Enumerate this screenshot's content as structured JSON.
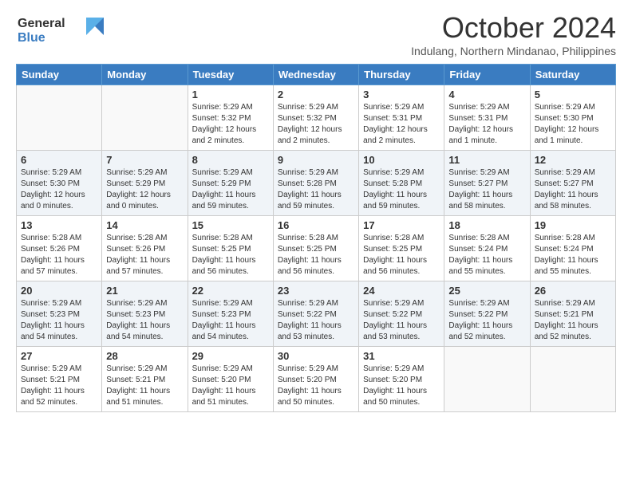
{
  "header": {
    "logo_line1": "General",
    "logo_line2": "Blue",
    "month": "October 2024",
    "location": "Indulang, Northern Mindanao, Philippines"
  },
  "days_of_week": [
    "Sunday",
    "Monday",
    "Tuesday",
    "Wednesday",
    "Thursday",
    "Friday",
    "Saturday"
  ],
  "weeks": [
    [
      {
        "day": "",
        "sunrise": "",
        "sunset": "",
        "daylight": ""
      },
      {
        "day": "",
        "sunrise": "",
        "sunset": "",
        "daylight": ""
      },
      {
        "day": "1",
        "sunrise": "Sunrise: 5:29 AM",
        "sunset": "Sunset: 5:32 PM",
        "daylight": "Daylight: 12 hours and 2 minutes."
      },
      {
        "day": "2",
        "sunrise": "Sunrise: 5:29 AM",
        "sunset": "Sunset: 5:32 PM",
        "daylight": "Daylight: 12 hours and 2 minutes."
      },
      {
        "day": "3",
        "sunrise": "Sunrise: 5:29 AM",
        "sunset": "Sunset: 5:31 PM",
        "daylight": "Daylight: 12 hours and 2 minutes."
      },
      {
        "day": "4",
        "sunrise": "Sunrise: 5:29 AM",
        "sunset": "Sunset: 5:31 PM",
        "daylight": "Daylight: 12 hours and 1 minute."
      },
      {
        "day": "5",
        "sunrise": "Sunrise: 5:29 AM",
        "sunset": "Sunset: 5:30 PM",
        "daylight": "Daylight: 12 hours and 1 minute."
      }
    ],
    [
      {
        "day": "6",
        "sunrise": "Sunrise: 5:29 AM",
        "sunset": "Sunset: 5:30 PM",
        "daylight": "Daylight: 12 hours and 0 minutes."
      },
      {
        "day": "7",
        "sunrise": "Sunrise: 5:29 AM",
        "sunset": "Sunset: 5:29 PM",
        "daylight": "Daylight: 12 hours and 0 minutes."
      },
      {
        "day": "8",
        "sunrise": "Sunrise: 5:29 AM",
        "sunset": "Sunset: 5:29 PM",
        "daylight": "Daylight: 11 hours and 59 minutes."
      },
      {
        "day": "9",
        "sunrise": "Sunrise: 5:29 AM",
        "sunset": "Sunset: 5:28 PM",
        "daylight": "Daylight: 11 hours and 59 minutes."
      },
      {
        "day": "10",
        "sunrise": "Sunrise: 5:29 AM",
        "sunset": "Sunset: 5:28 PM",
        "daylight": "Daylight: 11 hours and 59 minutes."
      },
      {
        "day": "11",
        "sunrise": "Sunrise: 5:29 AM",
        "sunset": "Sunset: 5:27 PM",
        "daylight": "Daylight: 11 hours and 58 minutes."
      },
      {
        "day": "12",
        "sunrise": "Sunrise: 5:29 AM",
        "sunset": "Sunset: 5:27 PM",
        "daylight": "Daylight: 11 hours and 58 minutes."
      }
    ],
    [
      {
        "day": "13",
        "sunrise": "Sunrise: 5:28 AM",
        "sunset": "Sunset: 5:26 PM",
        "daylight": "Daylight: 11 hours and 57 minutes."
      },
      {
        "day": "14",
        "sunrise": "Sunrise: 5:28 AM",
        "sunset": "Sunset: 5:26 PM",
        "daylight": "Daylight: 11 hours and 57 minutes."
      },
      {
        "day": "15",
        "sunrise": "Sunrise: 5:28 AM",
        "sunset": "Sunset: 5:25 PM",
        "daylight": "Daylight: 11 hours and 56 minutes."
      },
      {
        "day": "16",
        "sunrise": "Sunrise: 5:28 AM",
        "sunset": "Sunset: 5:25 PM",
        "daylight": "Daylight: 11 hours and 56 minutes."
      },
      {
        "day": "17",
        "sunrise": "Sunrise: 5:28 AM",
        "sunset": "Sunset: 5:25 PM",
        "daylight": "Daylight: 11 hours and 56 minutes."
      },
      {
        "day": "18",
        "sunrise": "Sunrise: 5:28 AM",
        "sunset": "Sunset: 5:24 PM",
        "daylight": "Daylight: 11 hours and 55 minutes."
      },
      {
        "day": "19",
        "sunrise": "Sunrise: 5:28 AM",
        "sunset": "Sunset: 5:24 PM",
        "daylight": "Daylight: 11 hours and 55 minutes."
      }
    ],
    [
      {
        "day": "20",
        "sunrise": "Sunrise: 5:29 AM",
        "sunset": "Sunset: 5:23 PM",
        "daylight": "Daylight: 11 hours and 54 minutes."
      },
      {
        "day": "21",
        "sunrise": "Sunrise: 5:29 AM",
        "sunset": "Sunset: 5:23 PM",
        "daylight": "Daylight: 11 hours and 54 minutes."
      },
      {
        "day": "22",
        "sunrise": "Sunrise: 5:29 AM",
        "sunset": "Sunset: 5:23 PM",
        "daylight": "Daylight: 11 hours and 54 minutes."
      },
      {
        "day": "23",
        "sunrise": "Sunrise: 5:29 AM",
        "sunset": "Sunset: 5:22 PM",
        "daylight": "Daylight: 11 hours and 53 minutes."
      },
      {
        "day": "24",
        "sunrise": "Sunrise: 5:29 AM",
        "sunset": "Sunset: 5:22 PM",
        "daylight": "Daylight: 11 hours and 53 minutes."
      },
      {
        "day": "25",
        "sunrise": "Sunrise: 5:29 AM",
        "sunset": "Sunset: 5:22 PM",
        "daylight": "Daylight: 11 hours and 52 minutes."
      },
      {
        "day": "26",
        "sunrise": "Sunrise: 5:29 AM",
        "sunset": "Sunset: 5:21 PM",
        "daylight": "Daylight: 11 hours and 52 minutes."
      }
    ],
    [
      {
        "day": "27",
        "sunrise": "Sunrise: 5:29 AM",
        "sunset": "Sunset: 5:21 PM",
        "daylight": "Daylight: 11 hours and 52 minutes."
      },
      {
        "day": "28",
        "sunrise": "Sunrise: 5:29 AM",
        "sunset": "Sunset: 5:21 PM",
        "daylight": "Daylight: 11 hours and 51 minutes."
      },
      {
        "day": "29",
        "sunrise": "Sunrise: 5:29 AM",
        "sunset": "Sunset: 5:20 PM",
        "daylight": "Daylight: 11 hours and 51 minutes."
      },
      {
        "day": "30",
        "sunrise": "Sunrise: 5:29 AM",
        "sunset": "Sunset: 5:20 PM",
        "daylight": "Daylight: 11 hours and 50 minutes."
      },
      {
        "day": "31",
        "sunrise": "Sunrise: 5:29 AM",
        "sunset": "Sunset: 5:20 PM",
        "daylight": "Daylight: 11 hours and 50 minutes."
      },
      {
        "day": "",
        "sunrise": "",
        "sunset": "",
        "daylight": ""
      },
      {
        "day": "",
        "sunrise": "",
        "sunset": "",
        "daylight": ""
      }
    ]
  ]
}
